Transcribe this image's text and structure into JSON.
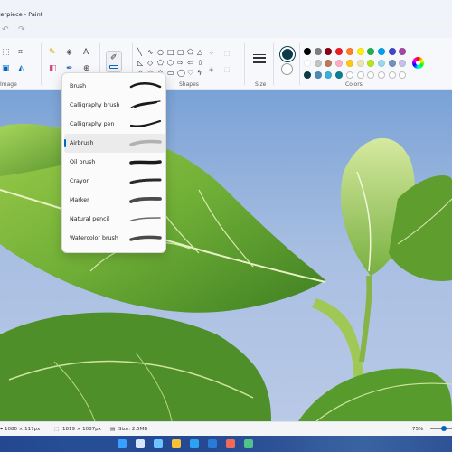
{
  "window": {
    "title": "terpiece - Paint"
  },
  "ribbon": {
    "groups": {
      "image": "Image",
      "shapes": "Shapes",
      "size": "Size",
      "colors": "Colors"
    }
  },
  "brush_menu": {
    "items": [
      {
        "label": "Brush",
        "selected": false
      },
      {
        "label": "Calligraphy brush",
        "selected": false
      },
      {
        "label": "Calligraphy pen",
        "selected": false
      },
      {
        "label": "Airbrush",
        "selected": true
      },
      {
        "label": "Oil brush",
        "selected": false
      },
      {
        "label": "Crayon",
        "selected": false
      },
      {
        "label": "Marker",
        "selected": false
      },
      {
        "label": "Natural pencil",
        "selected": false
      },
      {
        "label": "Watercolor brush",
        "selected": false
      }
    ]
  },
  "palette": {
    "primary": "#0b3b4a",
    "secondary": "#ffffff",
    "row1": [
      "#000000",
      "#7f7f7f",
      "#880015",
      "#ed1c24",
      "#ff7f27",
      "#fff200",
      "#22b14c",
      "#00a2e8",
      "#3f48cc",
      "#a349a4"
    ],
    "row2": [
      "#ffffff",
      "#c3c3c3",
      "#b97a57",
      "#ffaec9",
      "#ffc90e",
      "#efe4b0",
      "#b5e61d",
      "#99d9ea",
      "#7092be",
      "#c8bfe7"
    ],
    "row3": [
      "#0b3b4a",
      "#4d8bb5",
      "#3bb0d8",
      "#0e7e96",
      "",
      "",
      "",
      "",
      "",
      ""
    ]
  },
  "statusbar": {
    "cursor_pos": "1080 × 117px",
    "canvas_size": "1819 × 1087px",
    "file_size": "Size: 2.5MB",
    "zoom": "75%"
  },
  "icons": {
    "quick_access": [
      "undo-icon",
      "redo-icon"
    ],
    "tools": [
      "selection-icon",
      "crop-icon",
      "resize-icon",
      "rotate-icon",
      "pencil-icon",
      "fill-icon",
      "text-icon",
      "eraser-icon",
      "color-picker-icon",
      "magnifier-icon",
      "brush-icon"
    ]
  }
}
